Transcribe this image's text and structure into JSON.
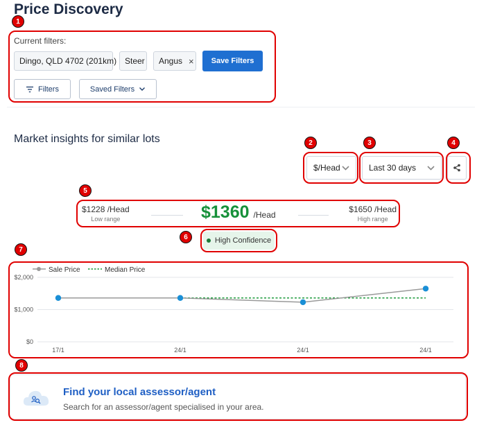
{
  "page": {
    "title": "Price Discovery"
  },
  "filters": {
    "label": "Current filters:",
    "chips": [
      {
        "label": "Dingo, QLD 4702 (201km)"
      },
      {
        "label": "Steer"
      },
      {
        "label": "Angus",
        "remove": "×"
      }
    ],
    "save_label": "Save Filters",
    "filters_label": "Filters",
    "saved_filters_label": "Saved Filters"
  },
  "insights": {
    "title": "Market insights for similar lots",
    "unit_select": "$/Head",
    "period_select": "Last 30 days",
    "share_icon": "share-icon"
  },
  "range": {
    "low_value": "$1228 /Head",
    "low_label": "Low range",
    "mid_value": "$1360",
    "mid_unit": "/Head",
    "high_value": "$1650 /Head",
    "high_label": "High range"
  },
  "confidence": {
    "label": "High Confidence",
    "color": "#1d7a39"
  },
  "chart_data": {
    "type": "line",
    "categories": [
      "17/1",
      "24/1",
      "24/1",
      "24/1"
    ],
    "series": [
      {
        "name": "Sale Price",
        "values": [
          1360,
          1360,
          1228,
          1650
        ]
      },
      {
        "name": "Median Price",
        "values": [
          1360,
          1360,
          1360,
          1360
        ]
      }
    ],
    "yticks": [
      "$2,000",
      "$1,000",
      "$0"
    ],
    "ylim": [
      0,
      2000
    ],
    "legend": "top-left",
    "grid": true
  },
  "agent": {
    "title": "Find your local assessor/agent",
    "subtitle": "Search for an assessor/agent specialised in your area."
  },
  "annotations": [
    "1",
    "2",
    "3",
    "4",
    "5",
    "6",
    "7",
    "8"
  ],
  "colors": {
    "accent": "#1f6fd1",
    "price_green": "#17913a",
    "annotation": "#e00000",
    "point_blue": "#1a8fd6"
  }
}
